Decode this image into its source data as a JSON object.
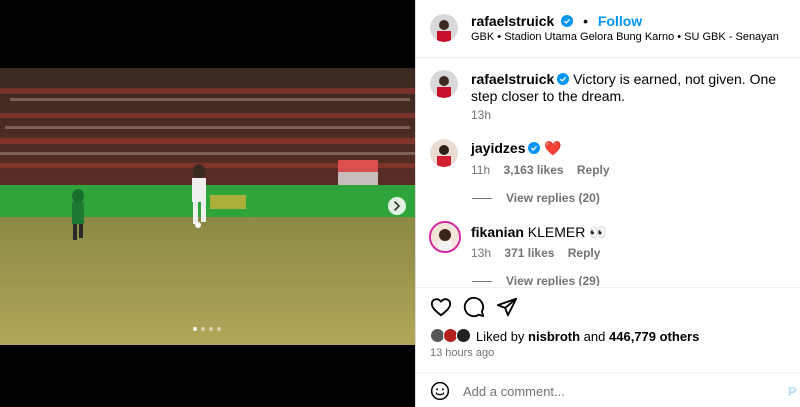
{
  "post": {
    "username": "rafaelstruick",
    "follow_label": "Follow",
    "location": "GBK • Stadion Utama Gelora Bung Karno • SU GBK - Senayan",
    "caption_text": "Victory is earned, not given. One step closer to the dream.",
    "caption_time": "13h",
    "carousel_dots": 4,
    "carousel_active": 0
  },
  "comments": [
    {
      "username": "jayidzes",
      "text": "❤️",
      "time": "11h",
      "likes": "3,163 likes",
      "reply_label": "Reply",
      "view_replies": "View replies (20)"
    },
    {
      "username": "fikanian",
      "text": "KLEMER 👀",
      "time": "13h",
      "likes": "371 likes",
      "reply_label": "Reply",
      "view_replies": "View replies (29)"
    }
  ],
  "likes": {
    "prefix": "Liked by",
    "user": "nisbroth",
    "joiner": "and",
    "others": "446,779 others"
  },
  "timestamp": "13 hours ago",
  "comment_box": {
    "placeholder": "Add a comment...",
    "post_label": "P"
  },
  "icons": {
    "verified": "verified-badge-icon",
    "like": "heart-outline-icon",
    "comment": "speech-bubble-icon",
    "share": "paper-plane-icon",
    "emoji": "smiley-face-icon",
    "next": "chevron-right-icon"
  },
  "colors": {
    "accent": "#0095f6",
    "verified": "#0095f6",
    "heart": "#e0245e",
    "muted": "#737373"
  }
}
